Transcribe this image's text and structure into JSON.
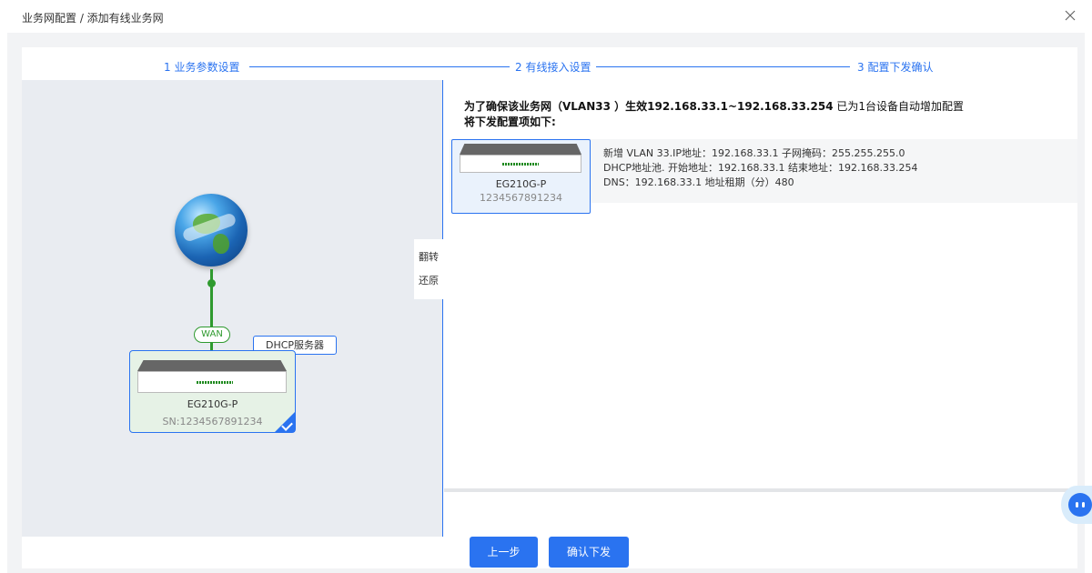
{
  "breadcrumb": "业务网配置 / 添加有线业务网",
  "steps": [
    "1 业务参数设置",
    "2 有线接入设置",
    "3 配置下发确认"
  ],
  "topology": {
    "wan_label": "WAN",
    "dhcp_label": "DHCP服务器",
    "device_model": "EG210G-P",
    "device_sn": "SN:1234567891234",
    "flip_label": "翻转",
    "restore_label": "还原"
  },
  "config": {
    "title_bold": "为了确保该业务网（VLAN33 ）生效192.168.33.1~192.168.33.254",
    "title_rest": " 已为1台设备自动增加配置",
    "subtitle": "将下发配置项如下:",
    "device_model": "EG210G-P",
    "device_sn": "1234567891234",
    "lines": [
      "新增 VLAN 33.IP地址：192.168.33.1 子网掩码：255.255.255.0",
      "DHCP地址池. 开始地址：192.168.33.1 结束地址：192.168.33.254",
      "DNS：192.168.33.1 地址租期（分）480"
    ]
  },
  "buttons": {
    "prev": "上一步",
    "confirm": "确认下发"
  },
  "colors": {
    "accent": "#2a73f0",
    "link_green": "#2f9a2f"
  }
}
